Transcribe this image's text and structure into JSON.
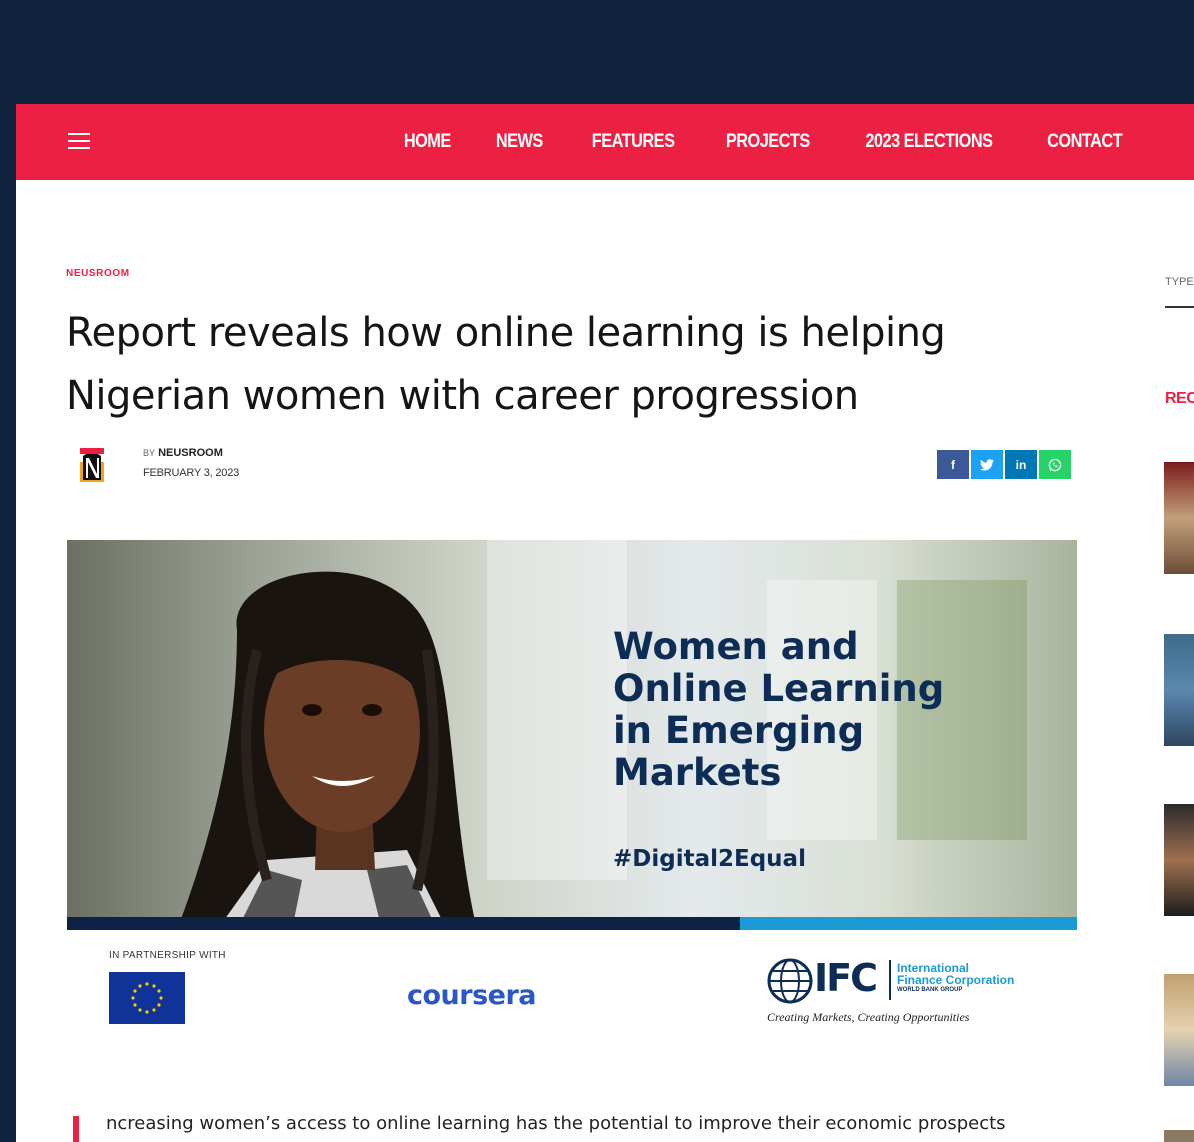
{
  "nav": {
    "items": [
      {
        "label": "HOME"
      },
      {
        "label": "NEWS"
      },
      {
        "label": "FEATURES"
      },
      {
        "label": "PROJECTS"
      },
      {
        "label": "2023 ELECTIONS"
      },
      {
        "label": "CONTACT"
      }
    ],
    "menu_icon": "hamburger-icon"
  },
  "article": {
    "category": "NEUSROOM",
    "title": "Report reveals how online learning is helping Nigerian women with career progression",
    "by_prefix": "BY",
    "author": "NEUSROOM",
    "date": "FEBRUARY 3, 2023",
    "body_first_line": "ncreasing women’s access to online learning has the potential to improve their economic prospects"
  },
  "share": {
    "facebook": "f",
    "twitter": "twitter-icon",
    "linkedin": "in",
    "whatsapp": "whatsapp-icon"
  },
  "hero": {
    "heading_lines": [
      "Women and",
      "Online Learning",
      "in Emerging",
      "Markets"
    ],
    "hashtag": "#Digital2Equal",
    "partner_label": "IN PARTNERSHIP WITH",
    "coursera": "coursera",
    "ifc_abbr": "IFC",
    "ifc_name_1": "International",
    "ifc_name_2": "Finance Corporation",
    "ifc_group": "WORLD BANK GROUP",
    "ifc_slogan": "Creating Markets, Creating Opportunities"
  },
  "sidebar": {
    "search_placeholder": "TYPE",
    "recent_heading": "REC"
  },
  "colors": {
    "brand_red": "#ec2043",
    "navy": "#0e2d56",
    "background": "#0f233d"
  }
}
